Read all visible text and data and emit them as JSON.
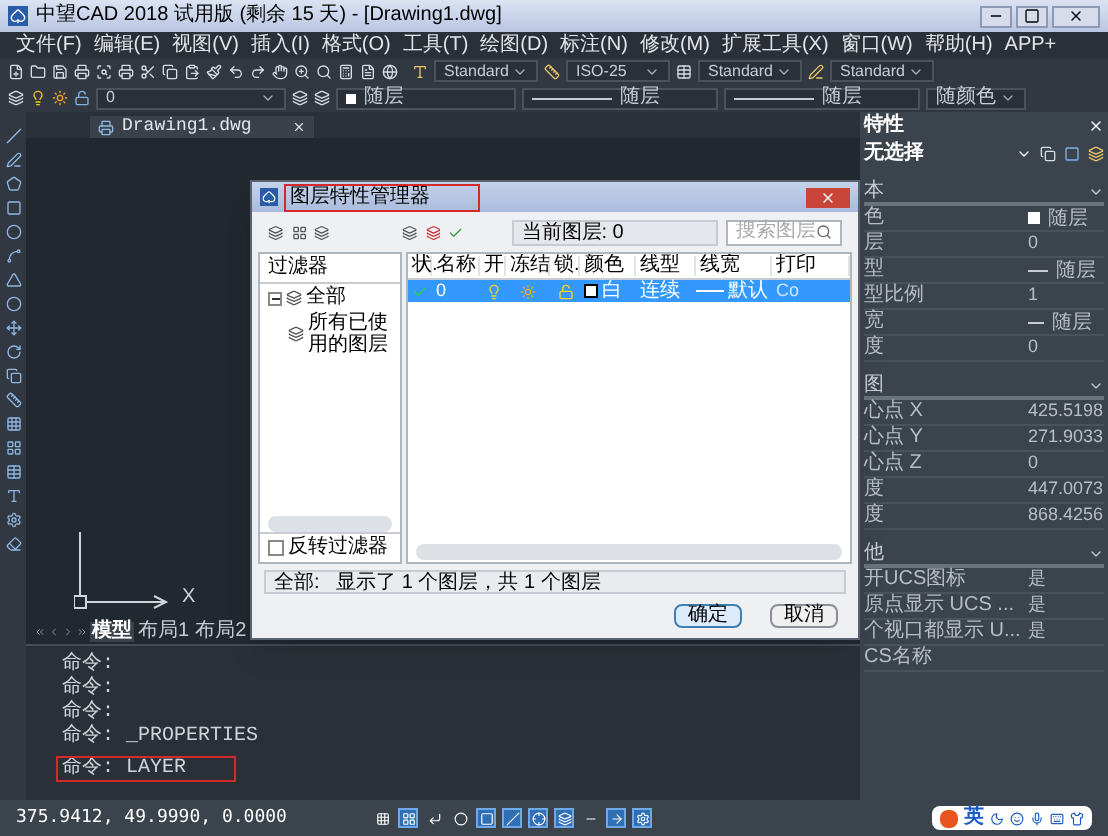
{
  "window": {
    "title": "中望CAD 2018 试用版 (剩余 15 天) - [Drawing1.dwg]"
  },
  "menu": [
    "文件(F)",
    "编辑(E)",
    "视图(V)",
    "插入(I)",
    "格式(O)",
    "工具(T)",
    "绘图(D)",
    "标注(N)",
    "修改(M)",
    "扩展工具(X)",
    "窗口(W)",
    "帮助(H)",
    "APP+"
  ],
  "style_toolbar": {
    "text_style": "Standard",
    "dim_style": "ISO-25",
    "table_style": "Standard",
    "mleader_style": "Standard"
  },
  "layer_toolbar": {
    "layer": "0",
    "color_setting": "随层",
    "linetype": "随层",
    "lineweight": "随层",
    "plot_style": "随颜色"
  },
  "document_tab": {
    "title": "Drawing1.dwg"
  },
  "ucs": {
    "x_label": "X"
  },
  "layout_tabs": [
    {
      "label": "模型",
      "selected": true
    },
    {
      "label": "布局1",
      "selected": false
    },
    {
      "label": "布局2",
      "selected": false
    }
  ],
  "command_lines": [
    {
      "text": "命令:",
      "highlighted": false
    },
    {
      "text": "命令:",
      "highlighted": false
    },
    {
      "text": "命令:",
      "highlighted": false
    },
    {
      "text": "命令: _PROPERTIES",
      "highlighted": false
    },
    {
      "text": "命令: LAYER",
      "highlighted": true
    }
  ],
  "properties": {
    "title": "特性",
    "selection": "无选择",
    "sections": [
      {
        "title": "本",
        "expanded": true,
        "rows": [
          {
            "label": "色",
            "value": "随层",
            "kind": "swatch"
          },
          {
            "label": "层",
            "value": "0",
            "kind": "text"
          },
          {
            "label": "型",
            "value": "随层",
            "kind": "line"
          },
          {
            "label": "型比例",
            "value": "1",
            "kind": "text"
          },
          {
            "label": "宽",
            "value": "随层",
            "kind": "short-line"
          },
          {
            "label": "度",
            "value": "0",
            "kind": "text"
          }
        ]
      },
      {
        "title": "图",
        "expanded": true,
        "rows": [
          {
            "label": "心点 X",
            "value": "425.5198",
            "kind": "text"
          },
          {
            "label": "心点 Y",
            "value": "271.9033",
            "kind": "text"
          },
          {
            "label": "心点 Z",
            "value": "0",
            "kind": "text"
          },
          {
            "label": "度",
            "value": "447.0073",
            "kind": "text"
          },
          {
            "label": "度",
            "value": "868.4256",
            "kind": "text"
          }
        ]
      },
      {
        "title": "他",
        "expanded": true,
        "rows": [
          {
            "label": "开UCS图标",
            "value": "是",
            "kind": "text"
          },
          {
            "label": "原点显示 UCS ...",
            "value": "是",
            "kind": "text"
          },
          {
            "label": "个视口都显示 U...",
            "value": "是",
            "kind": "text"
          },
          {
            "label": "CS名称",
            "value": "",
            "kind": "text"
          }
        ]
      }
    ]
  },
  "layer_dialog": {
    "title": "图层特性管理器",
    "title_highlighted": true,
    "current_layer": "当前图层: 0",
    "search_placeholder": "搜索图层",
    "filter_header": "过滤器",
    "filters": [
      {
        "label": "全部",
        "expanded": true,
        "children": [
          {
            "label": "所有已使用的图层"
          }
        ]
      }
    ],
    "invert_filter": {
      "label": "反转过滤器",
      "checked": false
    },
    "columns": [
      "状.",
      "名称",
      "开",
      "冻结",
      "锁.",
      "颜色",
      "线型",
      "线宽",
      "打印"
    ],
    "layers": [
      {
        "current": true,
        "name": "0",
        "on": true,
        "frozen": false,
        "locked": false,
        "color_name": "白",
        "color": "#ffffff",
        "linetype": "连续",
        "lineweight": "默认",
        "plot_style": "Co",
        "selected": true
      }
    ],
    "summary": "全部:   显示了 1 个图层，共 1 个图层",
    "buttons": [
      {
        "label": "确定",
        "default": true
      },
      {
        "label": "取消",
        "default": false
      }
    ]
  },
  "status_bar": {
    "coordinates": "375.9412, 49.9990, 0.0000",
    "toggles": [
      {
        "on": false
      },
      {
        "on": true
      },
      {
        "on": false
      },
      {
        "on": false
      },
      {
        "on": true
      },
      {
        "on": true
      },
      {
        "on": true
      },
      {
        "on": true
      },
      {
        "on": false
      },
      {
        "on": true
      },
      {
        "on": true
      }
    ]
  },
  "ime": {
    "mode": "英"
  }
}
